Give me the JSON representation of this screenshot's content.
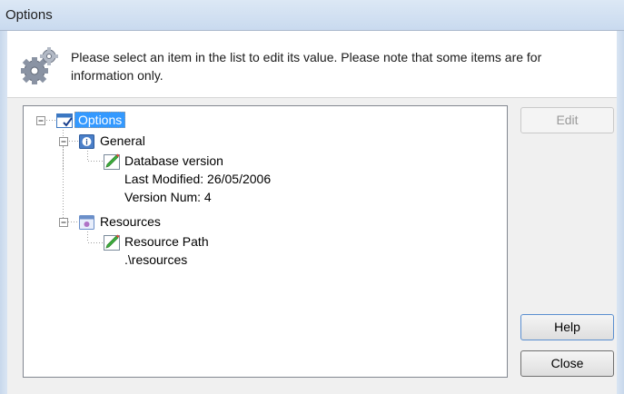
{
  "window": {
    "title": "Options"
  },
  "header": {
    "icon": "gears-icon",
    "message": "Please select an item in the list to edit its value. Please note that some items are for information only."
  },
  "tree": {
    "root": {
      "label": "Options",
      "icon": "checked-window-icon",
      "selected": true,
      "expanded": true,
      "children": [
        {
          "label": "General",
          "icon": "info-icon",
          "expanded": true,
          "children": [
            {
              "label": "Database version",
              "icon": "pencil-icon",
              "details": [
                "Last Modified: 26/05/2006",
                "Version Num: 4"
              ]
            }
          ]
        },
        {
          "label": "Resources",
          "icon": "resources-icon",
          "expanded": true,
          "children": [
            {
              "label": "Resource Path",
              "icon": "pencil-icon",
              "details": [
                ".\\resources"
              ]
            }
          ]
        }
      ]
    }
  },
  "buttons": {
    "edit": {
      "label": "Edit",
      "enabled": false
    },
    "help": {
      "label": "Help"
    },
    "close": {
      "label": "Close"
    }
  }
}
